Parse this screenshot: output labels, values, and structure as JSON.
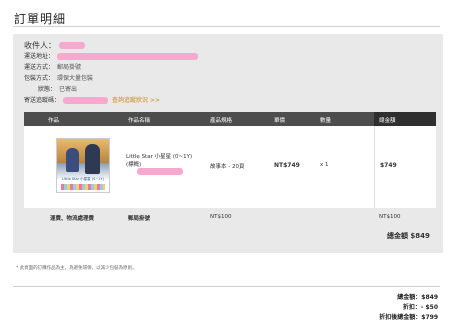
{
  "page": {
    "title": "訂單明細"
  },
  "recipient": {
    "name_label": "收件人：",
    "address_label": "運送地址：",
    "shipping_method_label": "運送方式：",
    "shipping_method_value": "郵局掛號",
    "packing_label": "包裝方式：",
    "packing_value": "環保大量包裝",
    "status_label": "狀態：",
    "status_value": "已寄出",
    "tracking_label": "寄送追蹤碼：",
    "tracking_link": "查詢追蹤狀況 >>"
  },
  "table": {
    "headers": [
      "作品",
      "作品名稱",
      "產品規格",
      "單價",
      "數量",
      "總金額"
    ],
    "item": {
      "thumb_text": "Little Star 小星星 (0~1Y)",
      "name_line1": "Little Star 小星星 (0~1Y)",
      "name_line2": "(標槪)",
      "spec": "故事本 - 20頁",
      "unit_price": "NT$749",
      "quantity": "x 1",
      "total": "$749"
    },
    "shipping": {
      "label": "運費、物流處理費",
      "method": "郵局掛號",
      "fee": "NT$100",
      "fee_total": "NT$100",
      "grand_total": "總金額 $849"
    }
  },
  "note": "* 此頁面的訂購作品為主，為避免環保，以減少包裝為原則。",
  "summary": {
    "total": "總金額：$849",
    "discount": "折扣：- $50",
    "after_discount": "折扣後總金額：$799"
  },
  "colors": {
    "redaction": "#f7a8cf",
    "header_bg": "#4d4d4d",
    "link": "#d0861f"
  }
}
